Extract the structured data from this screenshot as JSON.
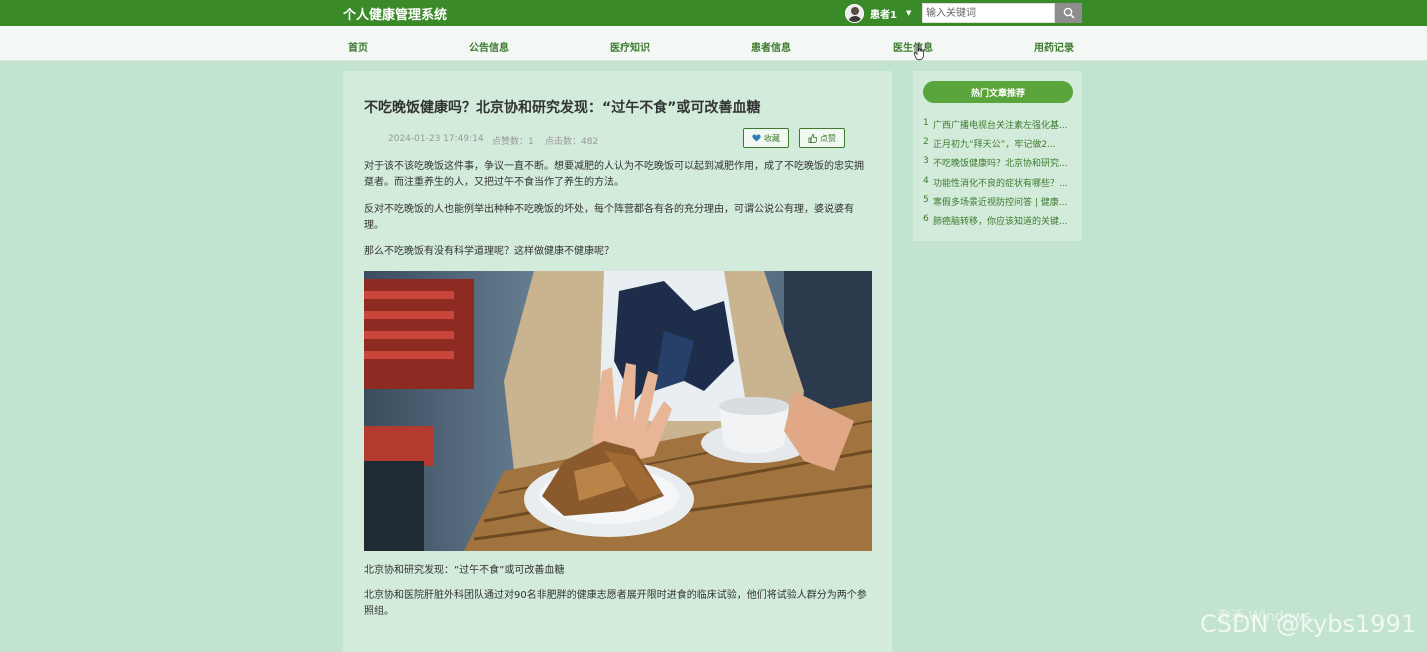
{
  "header": {
    "site_title": "个人健康管理系统",
    "username": "患者1",
    "search_placeholder": "输入关键词"
  },
  "nav": {
    "items": [
      {
        "label": "首页"
      },
      {
        "label": "公告信息"
      },
      {
        "label": "医疗知识"
      },
      {
        "label": "患者信息"
      },
      {
        "label": "医生信息"
      },
      {
        "label": "用药记录"
      }
    ]
  },
  "article": {
    "title": "不吃晚饭健康吗？北京协和研究发现：“过午不食”或可改善血糖",
    "date": "2024-01-23 17:49:14",
    "likes": "点赞数：1",
    "clicks": "点击数：482",
    "favorite_label": "收藏",
    "like_label": "点赞",
    "paragraphs": [
      "对于该不该吃晚饭这件事，争议一直不断。想要减肥的人认为不吃晚饭可以起到减肥作用，成了不吃晚饭的忠实拥趸者。而注重养生的人，又把过午不食当作了养生的方法。",
      "反对不吃晚饭的人也能例举出种种不吃晚饭的坏处，每个阵营都各有各的充分理由，可谓公说公有理，婆说婆有理。",
      "那么不吃晚饭有没有科学道理呢？这样做健康不健康呢？"
    ],
    "caption": "北京协和研究发现：“过午不食”或可改善血糖",
    "paragraph_after": "北京协和医院肝脏外科团队通过对90名非肥胖的健康志愿者展开限时进食的临床试验，他们将试验人群分为两个参照组。"
  },
  "sidebar": {
    "title": "热门文章推荐",
    "items": [
      {
        "num": "1",
        "text": "广西广播电视台关注素左强化基..."
      },
      {
        "num": "2",
        "text": "正月初九“拜天公”，牢记做2..."
      },
      {
        "num": "3",
        "text": "不吃晚饭健康吗？北京协和研究..."
      },
      {
        "num": "4",
        "text": "功能性消化不良的症状有哪些？..."
      },
      {
        "num": "5",
        "text": "寒假多场景近视防控问答 | 健康..."
      },
      {
        "num": "6",
        "text": "肺癌脑转移，你应该知道的关键..."
      }
    ]
  },
  "watermark": {
    "activate_text": "激活 Windows",
    "csdn_text": "CSDN @kybs1991"
  }
}
